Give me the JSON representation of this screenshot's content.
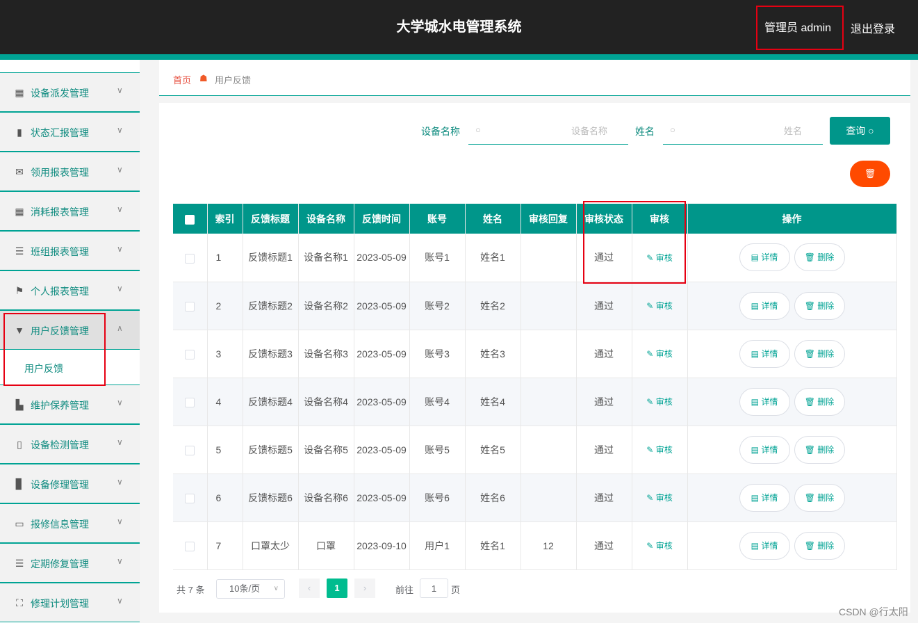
{
  "header": {
    "title": "大学城水电管理系统",
    "user": "管理员 admin",
    "logout": "退出登录"
  },
  "sidebar": {
    "items": [
      {
        "icon": "grid-icon",
        "glyph": "▦",
        "label": "设备派发管理"
      },
      {
        "icon": "bar-chart-icon",
        "glyph": "▮",
        "label": "状态汇报管理"
      },
      {
        "icon": "mail-icon",
        "glyph": "✉",
        "label": "领用报表管理"
      },
      {
        "icon": "grid-icon",
        "glyph": "▦",
        "label": "消耗报表管理"
      },
      {
        "icon": "list-icon",
        "glyph": "☰",
        "label": "班组报表管理"
      },
      {
        "icon": "flag-icon",
        "glyph": "⚑",
        "label": "个人报表管理"
      },
      {
        "icon": "feedback-icon",
        "glyph": "▼",
        "label": "用户反馈管理"
      },
      {
        "icon": "tools-icon",
        "glyph": "▙",
        "label": "维护保养管理"
      },
      {
        "icon": "device-icon",
        "glyph": "▯",
        "label": "设备检测管理"
      },
      {
        "icon": "book-icon",
        "glyph": "▊",
        "label": "设备修理管理"
      },
      {
        "icon": "chat-icon",
        "glyph": "▭",
        "label": "报修信息管理"
      },
      {
        "icon": "list-icon",
        "glyph": "☰",
        "label": "定期修复管理"
      },
      {
        "icon": "frame-icon",
        "glyph": "⛶",
        "label": "修理计划管理"
      }
    ],
    "sub_item": "用户反馈"
  },
  "breadcrumb": {
    "home": "首页",
    "current": "用户反馈"
  },
  "search": {
    "device_label": "设备名称",
    "device_placeholder": "设备名称",
    "name_label": "姓名",
    "name_placeholder": "姓名",
    "query_button": "查询"
  },
  "table": {
    "headers": [
      "索引",
      "反馈标题",
      "设备名称",
      "反馈时间",
      "账号",
      "姓名",
      "审核回复",
      "审核状态",
      "审核",
      "操作"
    ],
    "audit_link": "审核",
    "detail_button": "详情",
    "delete_button": "删除",
    "rows": [
      {
        "index": "1",
        "title": "反馈标题1",
        "device": "设备名称1",
        "time": "2023-05-09",
        "account": "账号1",
        "name": "姓名1",
        "reply": "",
        "status": "通过"
      },
      {
        "index": "2",
        "title": "反馈标题2",
        "device": "设备名称2",
        "time": "2023-05-09",
        "account": "账号2",
        "name": "姓名2",
        "reply": "",
        "status": "通过"
      },
      {
        "index": "3",
        "title": "反馈标题3",
        "device": "设备名称3",
        "time": "2023-05-09",
        "account": "账号3",
        "name": "姓名3",
        "reply": "",
        "status": "通过"
      },
      {
        "index": "4",
        "title": "反馈标题4",
        "device": "设备名称4",
        "time": "2023-05-09",
        "account": "账号4",
        "name": "姓名4",
        "reply": "",
        "status": "通过"
      },
      {
        "index": "5",
        "title": "反馈标题5",
        "device": "设备名称5",
        "time": "2023-05-09",
        "account": "账号5",
        "name": "姓名5",
        "reply": "",
        "status": "通过"
      },
      {
        "index": "6",
        "title": "反馈标题6",
        "device": "设备名称6",
        "time": "2023-05-09",
        "account": "账号6",
        "name": "姓名6",
        "reply": "",
        "status": "通过"
      },
      {
        "index": "7",
        "title": "口罩太少",
        "device": "口罩",
        "time": "2023-09-10",
        "account": "用户1",
        "name": "姓名1",
        "reply": "12",
        "status": "通过"
      }
    ]
  },
  "pagination": {
    "total": "共 7 条",
    "page_size": "10条/页",
    "current_page": "1",
    "goto_label": "前往",
    "goto_value": "1",
    "page_unit": "页"
  },
  "watermark": "CSDN @行太阳",
  "colors": {
    "header_bg": "#222222",
    "accent": "#00a394",
    "table_head": "#00968a",
    "danger": "#ff4a00",
    "highlight_box": "#e60012"
  }
}
